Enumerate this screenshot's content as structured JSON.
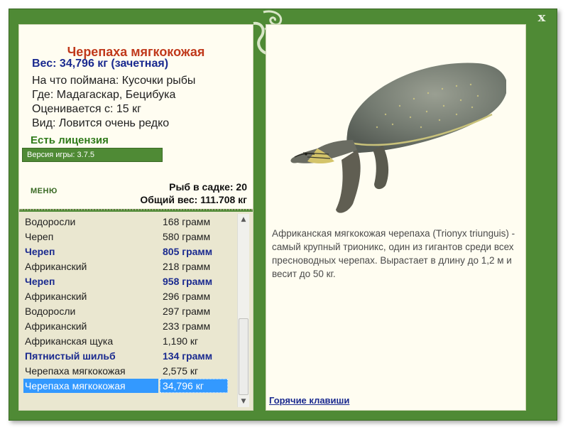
{
  "window": {
    "close_label": "x"
  },
  "fish": {
    "title": "Черепаха мягкокожая",
    "weight": "Вес: 34,796 кг (зачетная)",
    "bait": "На что поймана: Кусочки рыбы",
    "location": "Где: Мадагаскар, Бецибука",
    "value": "Оценивается с: 15 кг",
    "rarity": "Вид: Ловится очень редко"
  },
  "license": "Есть лицензия",
  "version": "Версия игры: 3.7.5",
  "menu_label": "МЕНЮ",
  "cage": {
    "count": "Рыб в садке: 20",
    "total": "Общий вес: 111.708 кг"
  },
  "catches": [
    {
      "name": "Водоросли",
      "weight": "168 грамм",
      "highlight": false,
      "selected": false
    },
    {
      "name": "Череп",
      "weight": "580 грамм",
      "highlight": false,
      "selected": false
    },
    {
      "name": "Череп",
      "weight": "805 грамм",
      "highlight": true,
      "selected": false
    },
    {
      "name": "Африканский",
      "weight": "218 грамм",
      "highlight": false,
      "selected": false
    },
    {
      "name": "Череп",
      "weight": "958 грамм",
      "highlight": true,
      "selected": false
    },
    {
      "name": "Африканский",
      "weight": "296 грамм",
      "highlight": false,
      "selected": false
    },
    {
      "name": "Водоросли",
      "weight": "297 грамм",
      "highlight": false,
      "selected": false
    },
    {
      "name": "Африканский",
      "weight": "233 грамм",
      "highlight": false,
      "selected": false
    },
    {
      "name": "Африканская щука",
      "weight": "1,190 кг",
      "highlight": false,
      "selected": false
    },
    {
      "name": "Пятнистый шильб",
      "weight": "134 грамм",
      "highlight": true,
      "selected": false
    },
    {
      "name": "Черепаха мягкокожая",
      "weight": "2,575 кг",
      "highlight": false,
      "selected": false
    },
    {
      "name": "Черепаха мягкокожая",
      "weight": "34,796 кг",
      "highlight": false,
      "selected": true
    }
  ],
  "description": "Африканская мягкокожая черепаха (Trionyx triunguis) - самый крупный трионикс, один из гигантов среди всех пресноводных черепах. Вырастает в длину до 1,2 м и весит до 50 кг.",
  "hotkeys_label": "Горячие клавиши",
  "colors": {
    "frame_green": "#4f8a35",
    "title_red": "#c0391b",
    "accent_blue": "#1a2a8f",
    "license_green": "#2f7a1a",
    "selection_blue": "#3399ff"
  }
}
